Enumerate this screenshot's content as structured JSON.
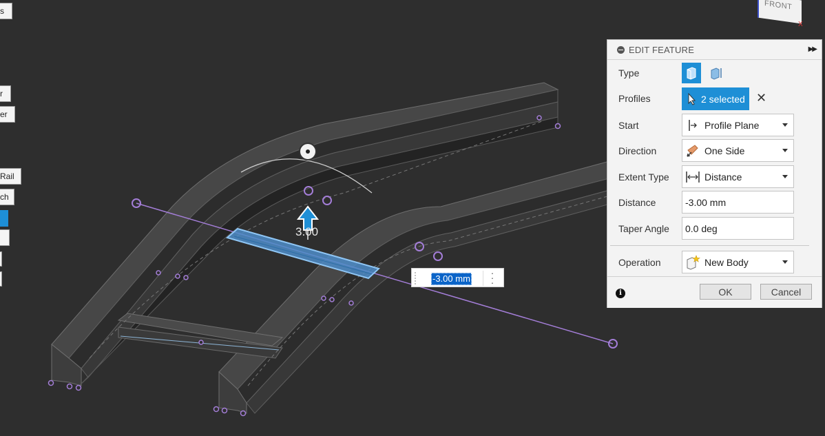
{
  "panel": {
    "title": "EDIT FEATURE",
    "labels": {
      "type": "Type",
      "profiles": "Profiles",
      "start": "Start",
      "direction": "Direction",
      "extent_type": "Extent Type",
      "distance": "Distance",
      "taper_angle": "Taper Angle",
      "operation": "Operation"
    },
    "profiles_value": "2 selected",
    "start_value": "Profile Plane",
    "direction_value": "One Side",
    "extent_type_value": "Distance",
    "distance_value": "-3.00 mm",
    "taper_angle_value": "0.0 deg",
    "operation_value": "New Body",
    "ok": "OK",
    "cancel": "Cancel"
  },
  "viewport": {
    "dimension_label": "3.00",
    "dimension_input": "-3.00 mm",
    "viewcube_face": "FRONT",
    "viewcube_axis": "X"
  },
  "left_buttons": [
    "s",
    "r",
    "er",
    "Rail",
    "ch",
    "",
    "",
    "",
    ""
  ],
  "colors": {
    "accent": "#1e8fd6",
    "background": "#2e2e2e",
    "sketch_line": "#a47ed8"
  }
}
